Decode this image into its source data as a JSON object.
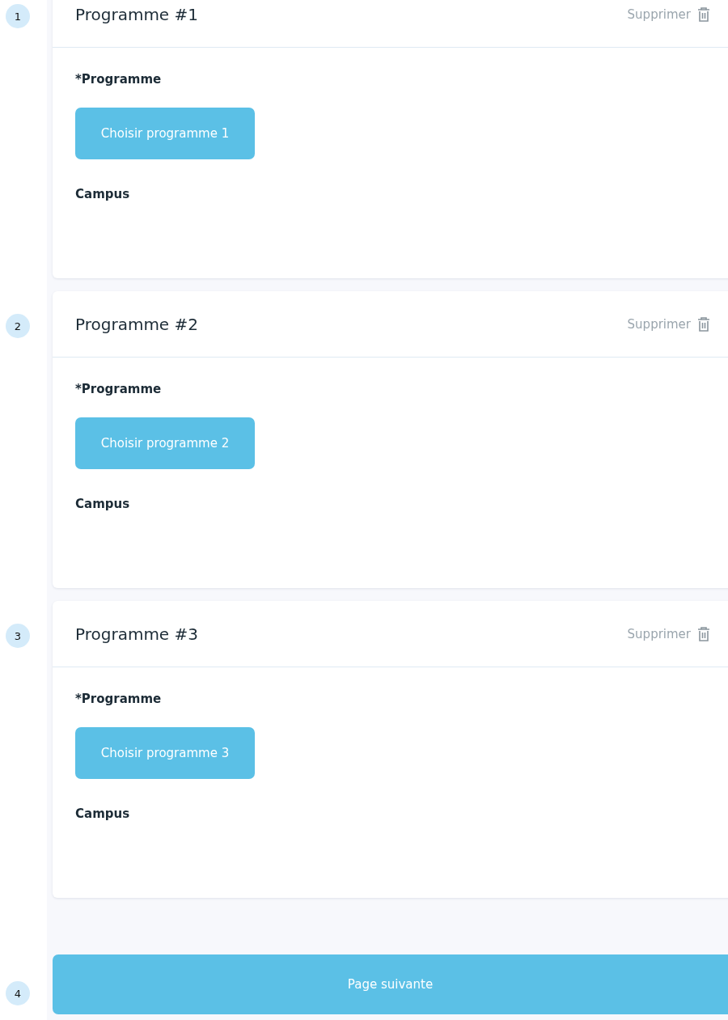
{
  "programmes": [
    {
      "marker": "1",
      "title": "Programme #1",
      "delete_label": "Supprimer",
      "field_label": "*Programme",
      "choose_button": "Choisir programme 1",
      "campus_label": "Campus"
    },
    {
      "marker": "2",
      "title": "Programme #2",
      "delete_label": "Supprimer",
      "field_label": "*Programme",
      "choose_button": "Choisir programme 2",
      "campus_label": "Campus"
    },
    {
      "marker": "3",
      "title": "Programme #3",
      "delete_label": "Supprimer",
      "field_label": "*Programme",
      "choose_button": "Choisir programme 3",
      "campus_label": "Campus"
    }
  ],
  "next_button": {
    "marker": "4",
    "label": "Page suivante"
  }
}
